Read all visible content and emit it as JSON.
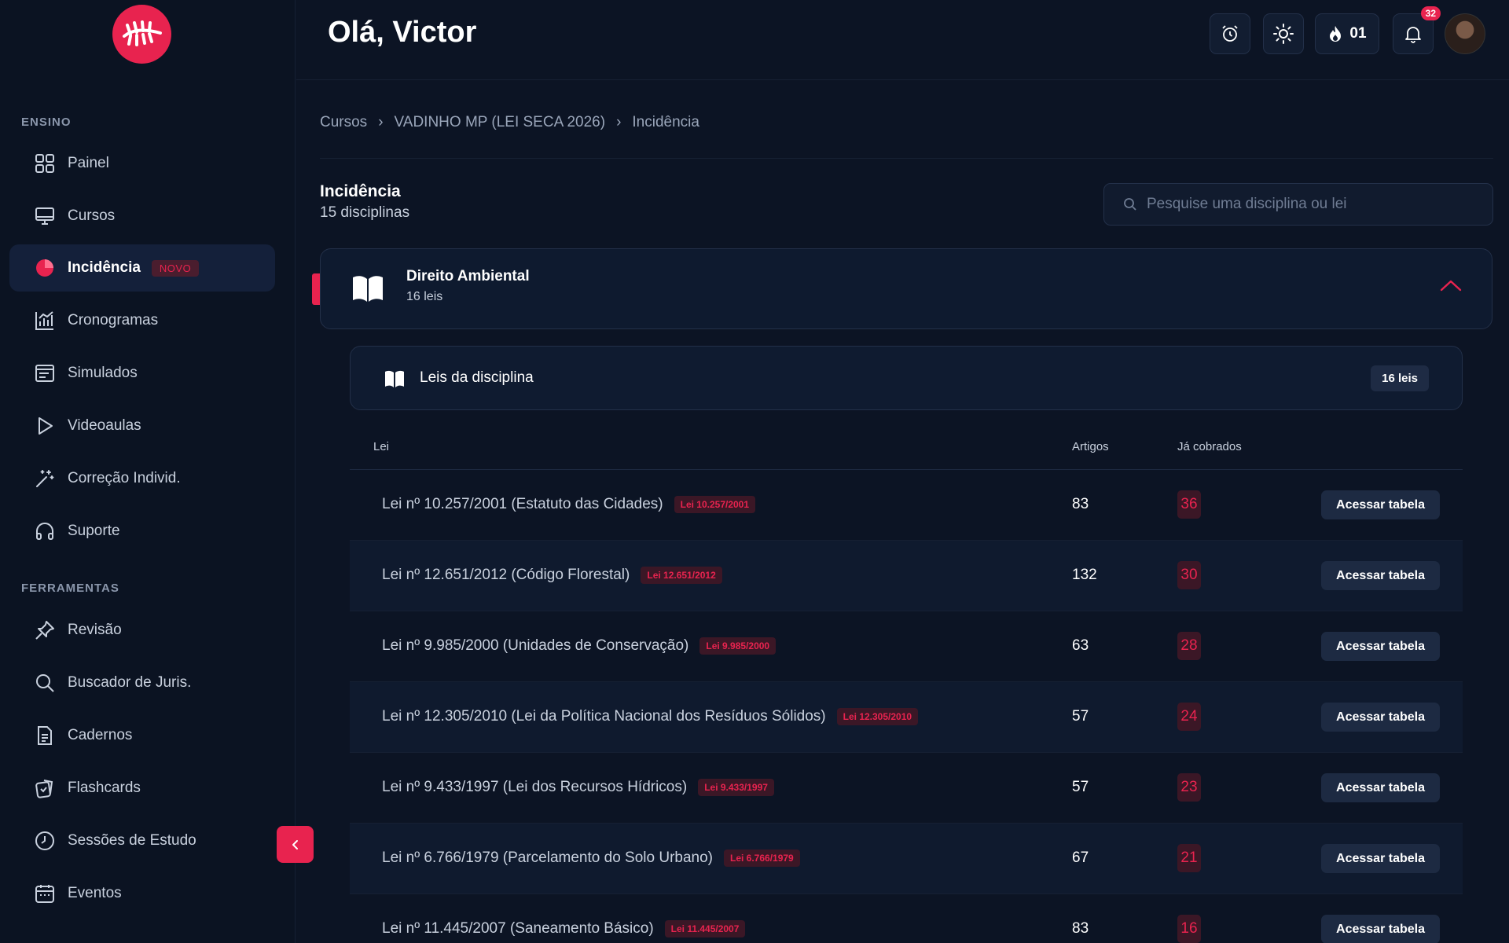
{
  "header": {
    "greeting": "Olá, Victor",
    "streak_count": "01",
    "notification_count": "32"
  },
  "sidebar": {
    "section_ensino": "ENSINO",
    "section_ferramentas": "FERRAMENTAS",
    "items": [
      {
        "label": "Painel",
        "icon": "grid-icon"
      },
      {
        "label": "Cursos",
        "icon": "monitor-icon"
      },
      {
        "label": "Incidência",
        "icon": "pie-chart-icon",
        "badge": "NOVO"
      },
      {
        "label": "Cronogramas",
        "icon": "bar-chart-icon"
      },
      {
        "label": "Simulados",
        "icon": "list-window-icon"
      },
      {
        "label": "Videoaulas",
        "icon": "play-icon"
      },
      {
        "label": "Correção Individ.",
        "icon": "magic-wand-icon"
      },
      {
        "label": "Suporte",
        "icon": "headphones-icon"
      }
    ],
    "tools": [
      {
        "label": "Revisão",
        "icon": "pin-icon"
      },
      {
        "label": "Buscador de Juris.",
        "icon": "search-icon"
      },
      {
        "label": "Cadernos",
        "icon": "document-icon"
      },
      {
        "label": "Flashcards",
        "icon": "flashcards-icon"
      },
      {
        "label": "Sessões de Estudo",
        "icon": "clock-icon"
      },
      {
        "label": "Eventos",
        "icon": "calendar-icon"
      }
    ]
  },
  "breadcrumb": [
    "Cursos",
    "VADINHO MP (LEI SECA 2026)",
    "Incidência"
  ],
  "page": {
    "title": "Incidência",
    "subtitle": "15 disciplinas",
    "search_placeholder": "Pesquise uma disciplina ou lei"
  },
  "discipline": {
    "title": "Direito Ambiental",
    "subtitle": "16 leis",
    "leis_title": "Leis da disciplina",
    "leis_count": "16 leis"
  },
  "table": {
    "headers": {
      "lei": "Lei",
      "artigos": "Artigos",
      "cobrados": "Já cobrados"
    },
    "button_label": "Acessar tabela",
    "rows": [
      {
        "lei": "Lei nº 10.257/2001 (Estatuto das Cidades)",
        "tag": "Lei 10.257/2001",
        "artigos": "83",
        "cobrados": "36"
      },
      {
        "lei": "Lei nº 12.651/2012 (Código Florestal)",
        "tag": "Lei 12.651/2012",
        "artigos": "132",
        "cobrados": "30"
      },
      {
        "lei": "Lei nº 9.985/2000 (Unidades de Conservação)",
        "tag": "Lei 9.985/2000",
        "artigos": "63",
        "cobrados": "28"
      },
      {
        "lei": "Lei nº 12.305/2010 (Lei da Política Nacional dos Resíduos Sólidos)",
        "tag": "Lei 12.305/2010",
        "artigos": "57",
        "cobrados": "24"
      },
      {
        "lei": "Lei nº 9.433/1997 (Lei dos Recursos Hídricos)",
        "tag": "Lei 9.433/1997",
        "artigos": "57",
        "cobrados": "23"
      },
      {
        "lei": "Lei nº 6.766/1979 (Parcelamento do Solo Urbano)",
        "tag": "Lei 6.766/1979",
        "artigos": "67",
        "cobrados": "21"
      },
      {
        "lei": "Lei nº 11.445/2007 (Saneamento Básico)",
        "tag": "Lei 11.445/2007",
        "artigos": "83",
        "cobrados": "16"
      }
    ]
  },
  "colors": {
    "accent": "#e8234f",
    "background": "#0c1424"
  }
}
